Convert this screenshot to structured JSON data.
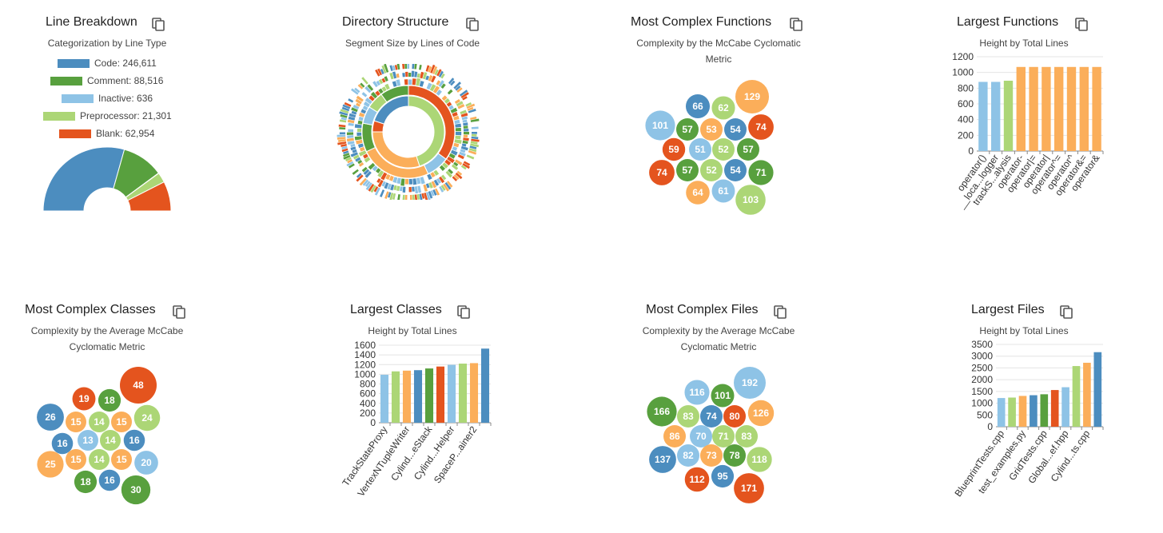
{
  "colors": {
    "blue": "#4c8dbf",
    "green": "#58a03e",
    "lightblue": "#8ec3e6",
    "lightgreen": "#acd676",
    "orange": "#fbae5a",
    "red": "#e4541e"
  },
  "icons": {
    "copy": "copy-icon"
  },
  "panels": {
    "line_breakdown": {
      "title": "Line Breakdown",
      "subtitle": "Categorization by Line Type"
    },
    "directory_structure": {
      "title": "Directory Structure",
      "subtitle": "Segment Size by Lines of Code"
    },
    "complex_functions": {
      "title": "Most Complex Functions",
      "subtitle": "Complexity by the McCabe Cyclomatic Metric"
    },
    "largest_functions": {
      "title": "Largest Functions",
      "subtitle": "Height by Total Lines"
    },
    "complex_classes": {
      "title": "Most Complex Classes",
      "subtitle": "Complexity by the Average McCabe Cyclomatic Metric"
    },
    "largest_classes": {
      "title": "Largest Classes",
      "subtitle": "Height by Total Lines"
    },
    "complex_files": {
      "title": "Most Complex Files",
      "subtitle": "Complexity by the Average McCabe Cyclomatic Metric"
    },
    "largest_files": {
      "title": "Largest Files",
      "subtitle": "Height by Total Lines"
    }
  },
  "chart_data": [
    {
      "id": "line_breakdown",
      "type": "pie",
      "subtype": "half-donut",
      "legend": [
        {
          "label": "Code: 246,611",
          "name": "Code",
          "value": 246611,
          "color": "#4c8dbf"
        },
        {
          "label": "Comment: 88,516",
          "name": "Comment",
          "value": 88516,
          "color": "#58a03e"
        },
        {
          "label": "Inactive: 636",
          "name": "Inactive",
          "value": 636,
          "color": "#8ec3e6"
        },
        {
          "label": "Preprocessor: 21,301",
          "name": "Preprocessor",
          "value": 21301,
          "color": "#acd676"
        },
        {
          "label": "Blank: 62,954",
          "name": "Blank",
          "value": 62954,
          "color": "#e4541e"
        }
      ]
    },
    {
      "id": "directory_structure",
      "type": "pie",
      "subtype": "sunburst",
      "inner_ring": [
        {
          "value": 45,
          "color": "#acd676"
        },
        {
          "value": 30,
          "color": "#fbae5a"
        },
        {
          "value": 5,
          "color": "#e4541e"
        },
        {
          "value": 20,
          "color": "#4c8dbf"
        }
      ],
      "middle_ring": [
        {
          "value": 35,
          "color": "#e4541e"
        },
        {
          "value": 8,
          "color": "#8ec3e6"
        },
        {
          "value": 25,
          "color": "#fbae5a"
        },
        {
          "value": 10,
          "color": "#58a03e"
        },
        {
          "value": 6,
          "color": "#8ec3e6"
        },
        {
          "value": 6,
          "color": "#acd676"
        },
        {
          "value": 10,
          "color": "#58a03e"
        }
      ]
    },
    {
      "id": "complex_functions",
      "type": "scatter",
      "subtype": "packed-bubble",
      "values": [
        129,
        66,
        62,
        101,
        57,
        53,
        54,
        74,
        59,
        51,
        52,
        57,
        74,
        57,
        52,
        54,
        71,
        64,
        61,
        103
      ],
      "colors": [
        "#fbae5a",
        "#4c8dbf",
        "#acd676",
        "#8ec3e6",
        "#58a03e",
        "#fbae5a",
        "#4c8dbf",
        "#e4541e",
        "#e4541e",
        "#8ec3e6",
        "#acd676",
        "#58a03e",
        "#e4541e",
        "#58a03e",
        "#acd676",
        "#4c8dbf",
        "#58a03e",
        "#fbae5a",
        "#8ec3e6",
        "#acd676"
      ]
    },
    {
      "id": "largest_functions",
      "type": "bar",
      "categories": [
        "operator()",
        "__loca...logger",
        "trackS...alysis",
        "operator-",
        "operator|=",
        "operator|",
        "operator^=",
        "operator^",
        "operator&=",
        "operator&"
      ],
      "values": [
        880,
        880,
        895,
        1070,
        1070,
        1070,
        1070,
        1070,
        1070,
        1070
      ],
      "colors": [
        "#8ec3e6",
        "#8ec3e6",
        "#acd676",
        "#fbae5a",
        "#fbae5a",
        "#fbae5a",
        "#fbae5a",
        "#fbae5a",
        "#fbae5a",
        "#fbae5a"
      ],
      "yticks": [
        0,
        200,
        400,
        600,
        800,
        1000,
        1200
      ],
      "ylim": [
        0,
        1200
      ]
    },
    {
      "id": "complex_classes",
      "type": "scatter",
      "subtype": "packed-bubble",
      "values": [
        48,
        19,
        18,
        26,
        15,
        14,
        15,
        24,
        16,
        13,
        14,
        16,
        25,
        15,
        14,
        15,
        20,
        18,
        16,
        30
      ],
      "colors": [
        "#e4541e",
        "#e4541e",
        "#58a03e",
        "#4c8dbf",
        "#fbae5a",
        "#acd676",
        "#fbae5a",
        "#acd676",
        "#4c8dbf",
        "#8ec3e6",
        "#acd676",
        "#4c8dbf",
        "#fbae5a",
        "#fbae5a",
        "#acd676",
        "#fbae5a",
        "#8ec3e6",
        "#58a03e",
        "#4c8dbf",
        "#58a03e"
      ]
    },
    {
      "id": "largest_classes",
      "type": "bar",
      "categories": [
        "TrackStateProxy",
        "",
        "VertexNTupleWriter",
        "",
        "Cylind...eStack",
        "",
        "Cylind...Helper",
        "",
        "SpaceP...ainer2",
        ""
      ],
      "values": [
        990,
        1060,
        1075,
        1085,
        1120,
        1160,
        1195,
        1220,
        1230,
        1530
      ],
      "colors": [
        "#8ec3e6",
        "#acd676",
        "#fbae5a",
        "#4c8dbf",
        "#58a03e",
        "#e4541e",
        "#8ec3e6",
        "#acd676",
        "#fbae5a",
        "#4c8dbf"
      ],
      "yticks": [
        0,
        200,
        400,
        600,
        800,
        1000,
        1200,
        1400,
        1600
      ],
      "ylim": [
        0,
        1600
      ]
    },
    {
      "id": "complex_files",
      "type": "scatter",
      "subtype": "packed-bubble",
      "values": [
        192,
        116,
        101,
        166,
        83,
        74,
        80,
        126,
        86,
        70,
        71,
        83,
        137,
        82,
        73,
        78,
        118,
        112,
        95,
        171
      ],
      "colors": [
        "#8ec3e6",
        "#8ec3e6",
        "#58a03e",
        "#58a03e",
        "#acd676",
        "#4c8dbf",
        "#e4541e",
        "#fbae5a",
        "#fbae5a",
        "#8ec3e6",
        "#acd676",
        "#acd676",
        "#4c8dbf",
        "#8ec3e6",
        "#fbae5a",
        "#58a03e",
        "#acd676",
        "#e4541e",
        "#4c8dbf",
        "#e4541e"
      ]
    },
    {
      "id": "largest_files",
      "type": "bar",
      "categories": [
        "BlueprintTests.cpp",
        "",
        "test_examples.py",
        "",
        "GridTests.cpp",
        "",
        "Global...ef.hpp",
        "",
        "Cylind...ts.cpp",
        ""
      ],
      "values": [
        1220,
        1240,
        1310,
        1340,
        1380,
        1560,
        1680,
        2580,
        2720,
        3170
      ],
      "colors": [
        "#8ec3e6",
        "#acd676",
        "#fbae5a",
        "#4c8dbf",
        "#58a03e",
        "#e4541e",
        "#8ec3e6",
        "#acd676",
        "#fbae5a",
        "#4c8dbf"
      ],
      "yticks": [
        0,
        500,
        1000,
        1500,
        2000,
        2500,
        3000,
        3500
      ],
      "ylim": [
        0,
        3500
      ]
    }
  ]
}
